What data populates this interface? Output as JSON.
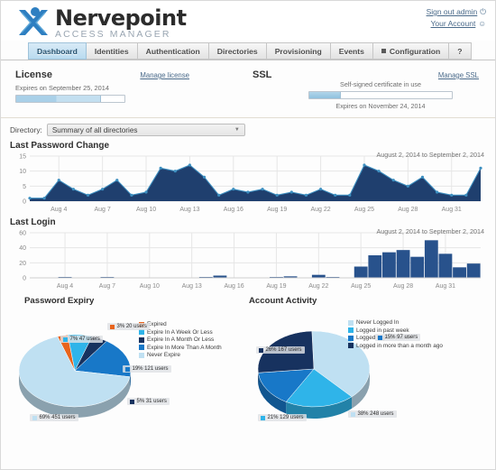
{
  "brand": {
    "title": "Nervepoint",
    "subtitle": "ACCESS MANAGER",
    "logo_icon": "nervepoint-x-logo"
  },
  "account": {
    "sign_out_label": "Sign out admin",
    "sign_out_icon": "power-icon",
    "your_account_label": "Your Account",
    "your_account_icon": "user-icon"
  },
  "nav": {
    "tabs": [
      {
        "label": "Dashboard",
        "active": true,
        "has_square": false
      },
      {
        "label": "Identities",
        "active": false,
        "has_square": false
      },
      {
        "label": "Authentication",
        "active": false,
        "has_square": false
      },
      {
        "label": "Directories",
        "active": false,
        "has_square": false
      },
      {
        "label": "Provisioning",
        "active": false,
        "has_square": false
      },
      {
        "label": "Events",
        "active": false,
        "has_square": false
      },
      {
        "label": "Configuration",
        "active": false,
        "has_square": true
      },
      {
        "label": "?",
        "active": false,
        "has_square": false
      }
    ]
  },
  "license": {
    "title": "License",
    "expires": "Expires on September 25, 2014",
    "manage_label": "Manage license",
    "progress_percent": 78
  },
  "ssl": {
    "title": "SSL",
    "status": "Self-signed certificate in use",
    "expires": "Expires on November 24, 2014",
    "manage_label": "Manage SSL",
    "progress_percent": 22
  },
  "directory": {
    "label": "Directory:",
    "selected": "Summary of all directories",
    "chevron_icon": "chevron-down-icon"
  },
  "colors": {
    "area_fill": "#1f3f6e",
    "area_point": "#3d8fc0",
    "bar_fill": "#28528c",
    "pale_blue": "#bfe0f2",
    "cyan": "#2fb4e9",
    "orange": "#e8641c",
    "mid_blue": "#1878c8",
    "navy": "#17325f",
    "accent": "#4a6a8a"
  },
  "chart_data": [
    {
      "type": "area",
      "title": "Last Password Change",
      "range_label": "August 2, 2014 to September 2, 2014",
      "xlabel": "",
      "ylabel": "",
      "ylim": [
        0,
        15
      ],
      "yticks": [
        0,
        5,
        10,
        15
      ],
      "grid": true,
      "tick_labels": [
        "Aug 4",
        "Aug 7",
        "Aug 10",
        "Aug 13",
        "Aug 16",
        "Aug 19",
        "Aug 22",
        "Aug 25",
        "Aug 28",
        "Aug 31"
      ],
      "x": [
        "Aug 2",
        "Aug 3",
        "Aug 4",
        "Aug 5",
        "Aug 6",
        "Aug 7",
        "Aug 8",
        "Aug 9",
        "Aug 10",
        "Aug 11",
        "Aug 12",
        "Aug 13",
        "Aug 14",
        "Aug 15",
        "Aug 16",
        "Aug 17",
        "Aug 18",
        "Aug 19",
        "Aug 20",
        "Aug 21",
        "Aug 22",
        "Aug 23",
        "Aug 24",
        "Aug 25",
        "Aug 26",
        "Aug 27",
        "Aug 28",
        "Aug 29",
        "Aug 30",
        "Aug 31",
        "Sep 1",
        "Sep 2"
      ],
      "values": [
        1,
        1,
        7,
        4,
        2,
        4,
        7,
        2,
        3,
        11,
        10,
        12,
        8,
        2,
        4,
        3,
        4,
        2,
        3,
        2,
        4,
        2,
        2,
        12,
        10,
        7,
        5,
        8,
        3,
        2,
        2,
        11
      ]
    },
    {
      "type": "bar",
      "title": "Last Login",
      "range_label": "August 2, 2014 to September 2, 2014",
      "xlabel": "",
      "ylabel": "",
      "ylim": [
        0,
        60
      ],
      "yticks": [
        0,
        20,
        40,
        60
      ],
      "grid": true,
      "tick_labels": [
        "Aug 4",
        "Aug 7",
        "Aug 10",
        "Aug 13",
        "Aug 16",
        "Aug 19",
        "Aug 22",
        "Aug 25",
        "Aug 28",
        "Aug 31"
      ],
      "categories": [
        "Aug 2",
        "Aug 3",
        "Aug 4",
        "Aug 5",
        "Aug 6",
        "Aug 7",
        "Aug 8",
        "Aug 9",
        "Aug 10",
        "Aug 11",
        "Aug 12",
        "Aug 13",
        "Aug 14",
        "Aug 15",
        "Aug 16",
        "Aug 17",
        "Aug 18",
        "Aug 19",
        "Aug 20",
        "Aug 21",
        "Aug 22",
        "Aug 23",
        "Aug 24",
        "Aug 25",
        "Aug 26",
        "Aug 27",
        "Aug 28",
        "Aug 29",
        "Aug 30",
        "Aug 31",
        "Sep 1",
        "Sep 2"
      ],
      "values": [
        0,
        0,
        1,
        0,
        0,
        1,
        0,
        0,
        0,
        0,
        0,
        0,
        1,
        3,
        0,
        0,
        0,
        1,
        2,
        0,
        4,
        1,
        0,
        15,
        30,
        34,
        37,
        28,
        50,
        32,
        14,
        19
      ]
    },
    {
      "type": "pie",
      "title": "Password Expiry",
      "legend_position": "right",
      "categories": [
        "Expired",
        "Expire In A Week Or Less",
        "Expire In A Month Or Less",
        "Expire In More Than A Month",
        "Never Expire"
      ],
      "colors": [
        "#e8641c",
        "#2fb4e9",
        "#17325f",
        "#1878c8",
        "#bfe0f2"
      ],
      "values": [
        20,
        47,
        31,
        121,
        451
      ],
      "percents": [
        3,
        7,
        5,
        19,
        69
      ],
      "labels": [
        "3% 20 users",
        "7% 47 users",
        "5% 31 users",
        "19% 121 users",
        "69% 451 users"
      ]
    },
    {
      "type": "pie",
      "title": "Account Activity",
      "legend_position": "right",
      "categories": [
        "Never Logged In",
        "Logged in past week",
        "Logged in past month",
        "Logged in more than a month ago"
      ],
      "colors": [
        "#bfe0f2",
        "#2fb4e9",
        "#1878c8",
        "#17325f"
      ],
      "values": [
        248,
        129,
        97,
        167
      ],
      "percents": [
        38,
        21,
        15,
        26
      ],
      "labels": [
        "38% 248 users",
        "21% 129 users",
        "15% 97 users",
        "26% 167 users"
      ]
    }
  ]
}
